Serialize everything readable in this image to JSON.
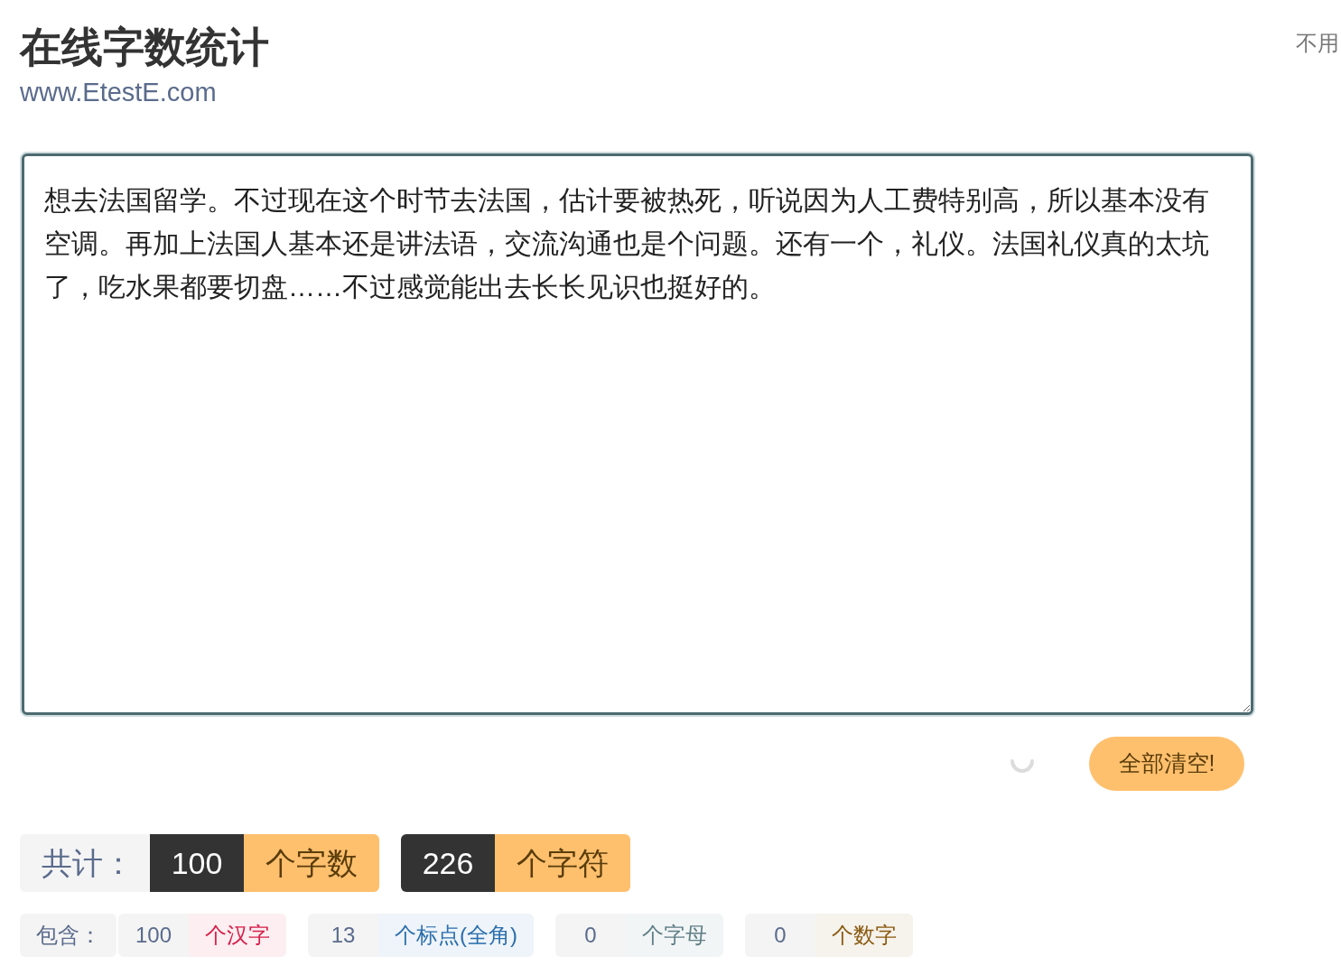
{
  "header": {
    "title": "在线字数统计",
    "subtitle": "www.EtestE.com",
    "corner_link": "不用"
  },
  "editor": {
    "text": "想去法国留学。不过现在这个时节去法国，估计要被热死，听说因为人工费特别高，所以基本没有空调。再加上法国人基本还是讲法语，交流沟通也是个问题。还有一个，礼仪。法国礼仪真的太坑了，吃水果都要切盘……不过感觉能出去长长见识也挺好的。"
  },
  "clear_button": "全部清空!",
  "totals": {
    "label": "共计：",
    "items": [
      {
        "count": "100",
        "unit": "个字数"
      },
      {
        "count": "226",
        "unit": "个字符"
      }
    ]
  },
  "breakdown": {
    "label": "包含：",
    "items": [
      {
        "count": "100",
        "unit": "个汉字",
        "color": "#d6204a"
      },
      {
        "count": "13",
        "unit": "个标点(全角)",
        "color": "#2a6ead"
      },
      {
        "count": "0",
        "unit": "个字母",
        "color": "#5f7f86"
      },
      {
        "count": "0",
        "unit": "个数字",
        "color": "#8a5a10"
      }
    ]
  }
}
